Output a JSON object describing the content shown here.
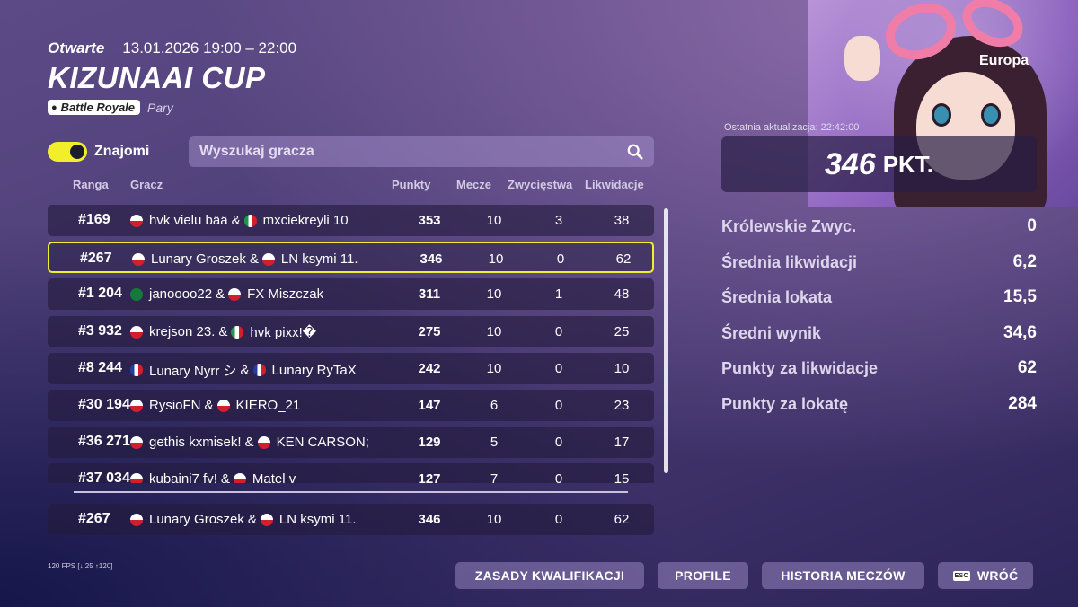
{
  "event": {
    "status": "Otwarte",
    "datetime": "13.01.2026 19:00 – 22:00",
    "title": "KIZUNAAI CUP",
    "mode": "Battle Royale",
    "team_type": "Pary"
  },
  "filters": {
    "friends_label": "Znajomi",
    "friends_on": true,
    "search_placeholder": "Wyszukaj gracza"
  },
  "columns": {
    "rank": "Ranga",
    "player": "Gracz",
    "points": "Punkty",
    "matches": "Mecze",
    "wins": "Zwycięstwa",
    "eliminations": "Likwidacje"
  },
  "rows": [
    {
      "rank": "#169",
      "p1_flag": "pl",
      "p1": "hvk vielu bää",
      "p2_flag": "it",
      "p2": "mxciekreyli 10",
      "points": "353",
      "matches": "10",
      "wins": "3",
      "elims": "38"
    },
    {
      "rank": "#267",
      "p1_flag": "pl",
      "p1": "Lunary Groszek",
      "p2_flag": "pl",
      "p2": "LN ksymi 11.",
      "points": "346",
      "matches": "10",
      "wins": "0",
      "elims": "62"
    },
    {
      "rank": "#1 204",
      "p1_flag": "sa",
      "p1": "janoooo22",
      "p2_flag": "pl",
      "p2": "FX Miszczak",
      "points": "311",
      "matches": "10",
      "wins": "1",
      "elims": "48"
    },
    {
      "rank": "#3 932",
      "p1_flag": "pl",
      "p1": "krejson 23.",
      "p2_flag": "it",
      "p2": "hvk pixx!�",
      "points": "275",
      "matches": "10",
      "wins": "0",
      "elims": "25"
    },
    {
      "rank": "#8 244",
      "p1_flag": "fr",
      "p1": "Lunary Nyrr シ",
      "p2_flag": "fr",
      "p2": "Lunary RyTaX",
      "points": "242",
      "matches": "10",
      "wins": "0",
      "elims": "10"
    },
    {
      "rank": "#30 194",
      "p1_flag": "pl",
      "p1": "RysioFN",
      "p2_flag": "pl",
      "p2": "KIERO_21",
      "points": "147",
      "matches": "6",
      "wins": "0",
      "elims": "23"
    },
    {
      "rank": "#36 271",
      "p1_flag": "pl",
      "p1": "gethis kxmisek!",
      "p2_flag": "pl",
      "p2": "KEN CARSON;",
      "points": "129",
      "matches": "5",
      "wins": "0",
      "elims": "17"
    },
    {
      "rank": "#37 034",
      "p1_flag": "pl",
      "p1": "kubaini7 fv!",
      "p2_flag": "pl",
      "p2": "Matel v",
      "points": "127",
      "matches": "7",
      "wins": "0",
      "elims": "15"
    }
  ],
  "my_row": {
    "rank": "#267",
    "p1_flag": "pl",
    "p1": "Lunary Groszek",
    "p2_flag": "pl",
    "p2": "LN ksymi 11.",
    "points": "346",
    "matches": "10",
    "wins": "0",
    "elims": "62"
  },
  "summary": {
    "region": "Europa",
    "last_update": "Ostatnia aktualizacja: 22:42:00",
    "score": "346",
    "score_unit": "PKT.",
    "stats": [
      {
        "label": "Królewskie Zwyc.",
        "value": "0"
      },
      {
        "label": "Średnia likwidacji",
        "value": "6,2"
      },
      {
        "label": "Średnia lokata",
        "value": "15,5"
      },
      {
        "label": "Średni wynik",
        "value": "34,6"
      },
      {
        "label": "Punkty za likwidacje",
        "value": "62"
      },
      {
        "label": "Punkty za lokatę",
        "value": "284"
      }
    ]
  },
  "footer": {
    "qualification": "ZASADY KWALIFIKACJI",
    "profile": "PROFILE",
    "history": "HISTORIA MECZÓW",
    "back": "WRÓĆ",
    "esc": "ESC",
    "fps": "120 FPS [↓ 25 ↑120]"
  },
  "colors": {
    "accent": "#f3ee2a",
    "row_bg": "#231c3e",
    "background": "#4e3f78"
  }
}
